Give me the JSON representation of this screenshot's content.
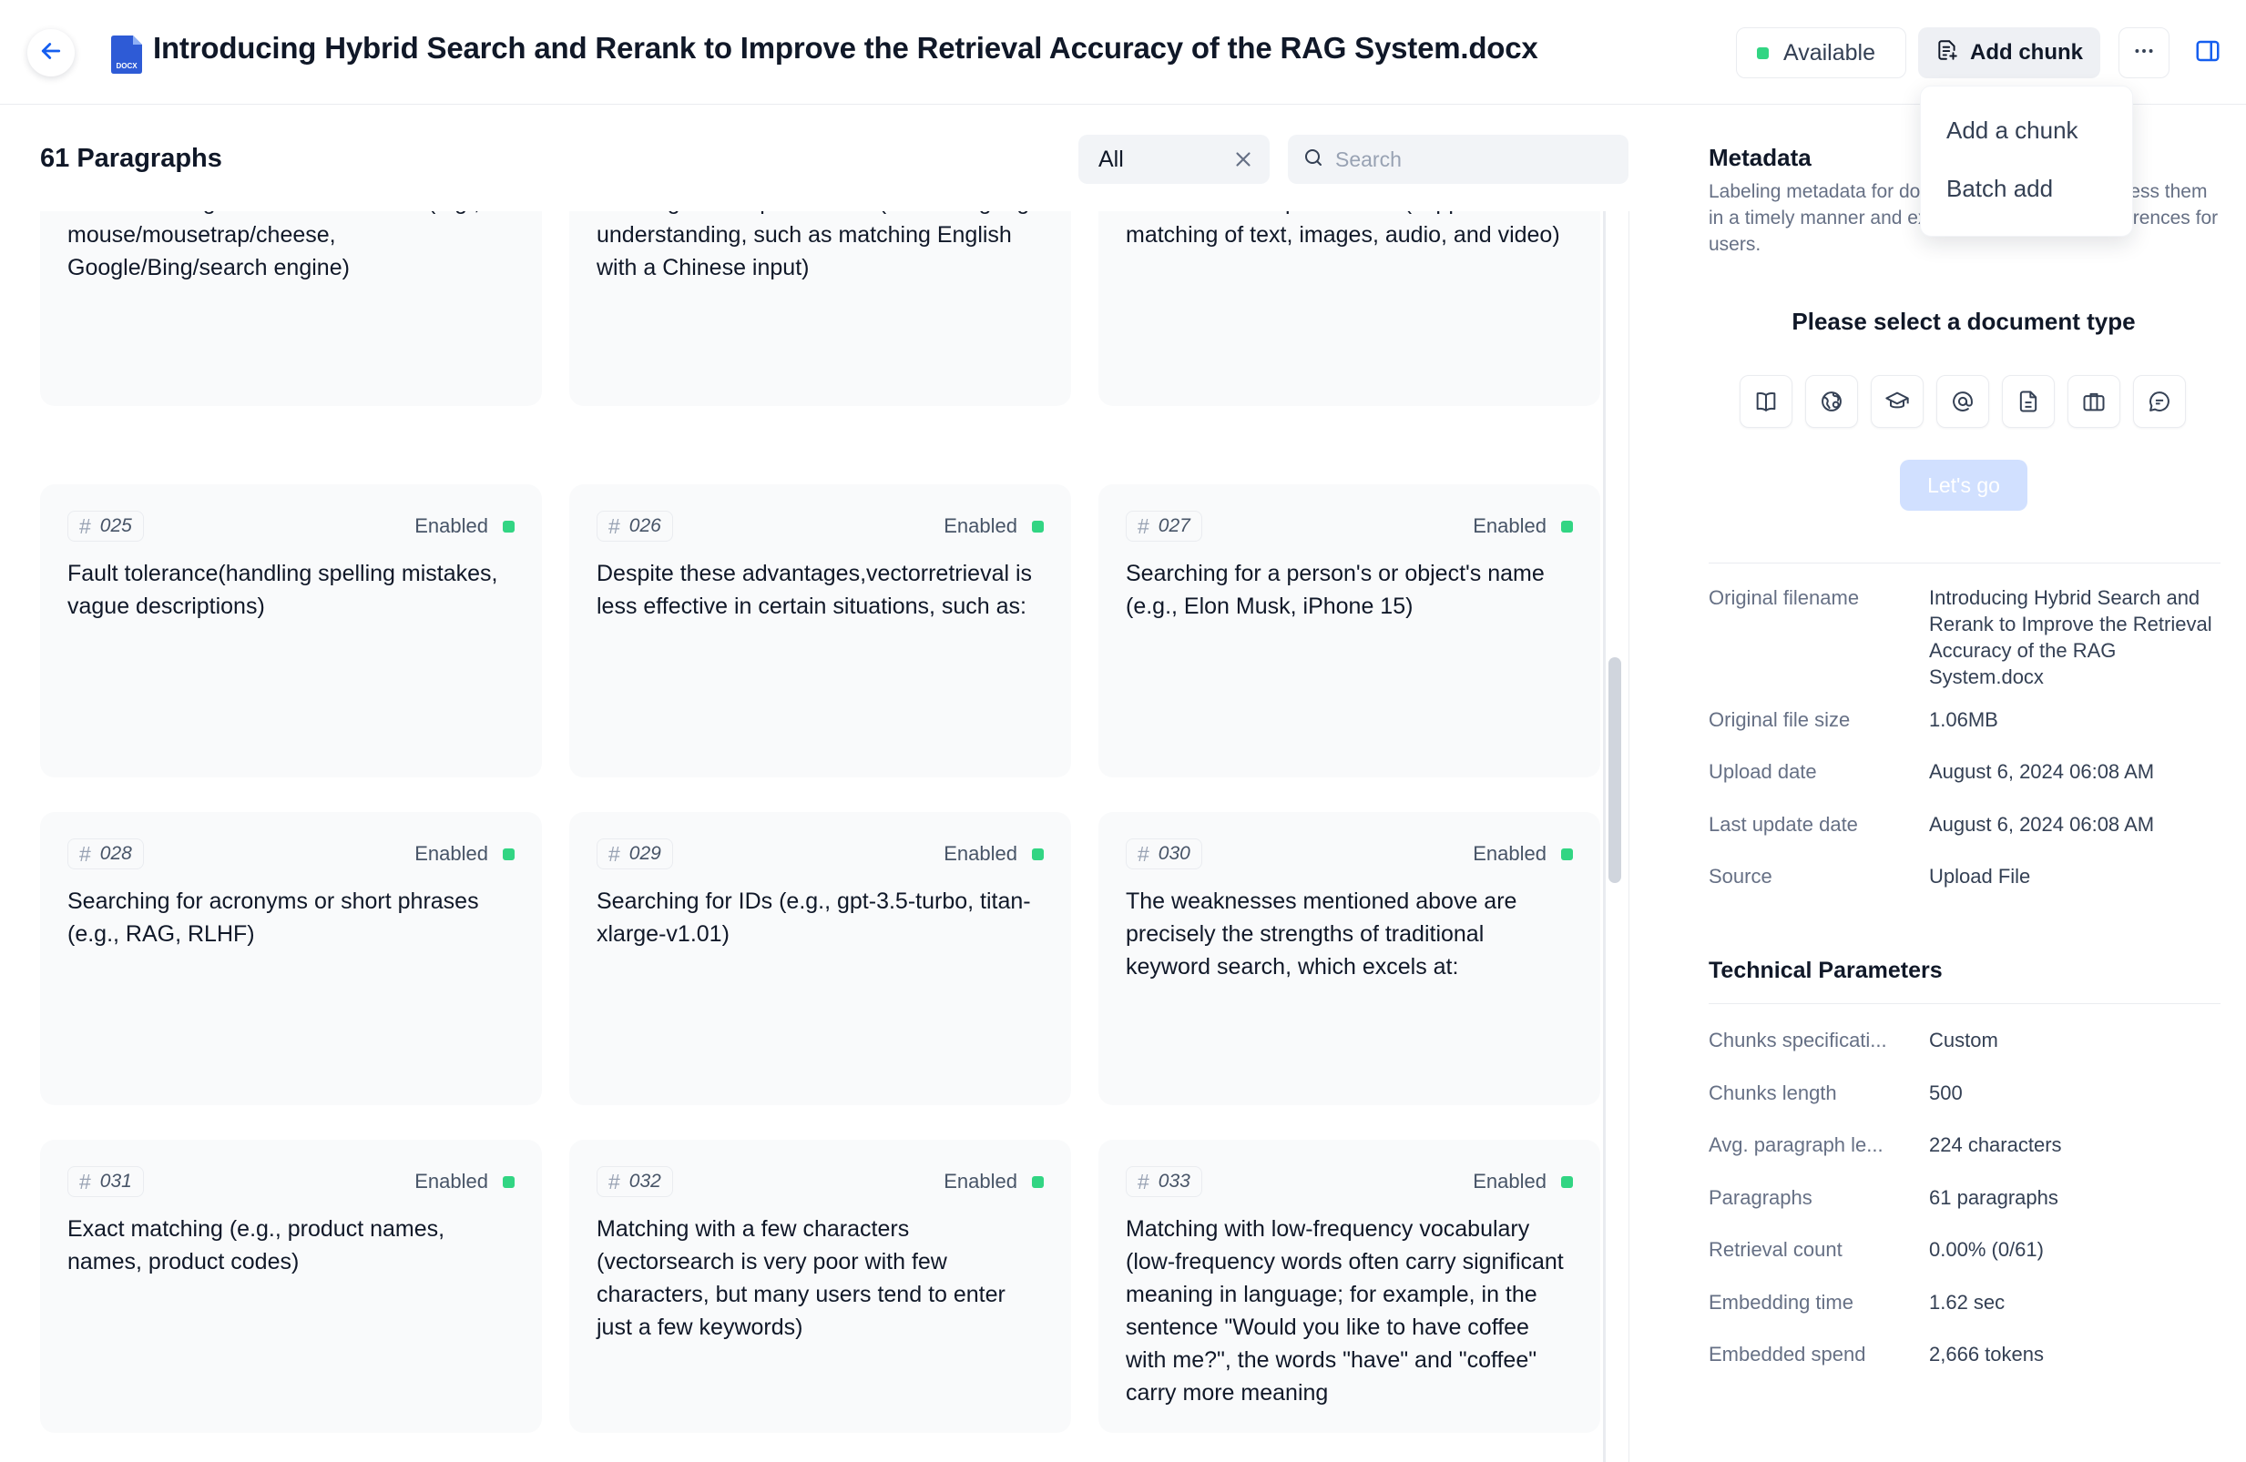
{
  "header": {
    "title": "Introducing Hybrid Search and Rerank to Improve the Retrieval Accuracy of the RAG System.docx",
    "file_badge": "DOCX",
    "status": "Available",
    "status_color": "#32d583",
    "add_chunk_label": "Add chunk",
    "icons": {
      "back": "arrow-left-icon",
      "file": "docx-file-icon",
      "add": "add-chunk-icon",
      "more": "more-horizontal-icon",
      "panel": "panel-toggle-icon"
    }
  },
  "dropdown": {
    "items": [
      "Add a chunk",
      "Batch add"
    ]
  },
  "list": {
    "count_label": "61 Paragraphs",
    "filter_value": "All",
    "search_placeholder": "Search"
  },
  "cards": [
    {
      "num": "",
      "status": "",
      "text": "Understanding of similar semantics (e.g., mouse/mousetrap/cheese, Google/Bing/search engine)"
    },
    {
      "num": "",
      "status": "",
      "text": "Multilingual comprehension (cross-language understanding, such as matching English with a Chinese input)"
    },
    {
      "num": "",
      "status": "",
      "text": "Multimodal comprehension (supports similar matching of text, images, audio, and video)"
    },
    {
      "num": "025",
      "status": "Enabled",
      "text": "Fault tolerance(handling spelling mistakes, vague descriptions)"
    },
    {
      "num": "026",
      "status": "Enabled",
      "text": "Despite these advantages,vectorretrieval is less effective in certain situations, such as:"
    },
    {
      "num": "027",
      "status": "Enabled",
      "text": "Searching for a person's or object's name (e.g., Elon Musk, iPhone 15)"
    },
    {
      "num": "028",
      "status": "Enabled",
      "text": "Searching for acronyms or short phrases (e.g., RAG, RLHF)"
    },
    {
      "num": "029",
      "status": "Enabled",
      "text": "Searching for IDs (e.g., gpt-3.5-turbo, titan-xlarge-v1.01)"
    },
    {
      "num": "030",
      "status": "Enabled",
      "text": "The weaknesses mentioned above are precisely the strengths of traditional keyword search, which excels at:"
    },
    {
      "num": "031",
      "status": "Enabled",
      "text": "Exact matching (e.g., product names, names, product codes)"
    },
    {
      "num": "032",
      "status": "Enabled",
      "text": "Matching with a few characters (vectorsearch is very poor with few characters, but many users tend to enter just a few keywords)"
    },
    {
      "num": "033",
      "status": "Enabled",
      "text": "Matching with low-frequency vocabulary (low-frequency words often carry significant meaning in language; for example, in the sentence \"Would you like to have coffee with me?\", the words \"have\" and \"coffee\" carry more meaning"
    }
  ],
  "metadata": {
    "title": "Metadata",
    "description": "Labeling metadata for documents allows AI to access them in a timely manner and exposes the source of references for users.",
    "select_type_label": "Please select a document type",
    "type_icons": [
      "book-icon",
      "web-icon",
      "graduation-cap-icon",
      "at-sign-icon",
      "file-text-icon",
      "briefcase-icon",
      "chat-bubble-icon"
    ],
    "lets_go_label": "Let's go",
    "info": [
      {
        "label": "Original filename",
        "value": "Introducing Hybrid Search and Rerank to Improve the Retrieval Accuracy of the RAG System.docx"
      },
      {
        "label": "Original file size",
        "value": "1.06MB"
      },
      {
        "label": "Upload date",
        "value": "August 6, 2024 06:08 AM"
      },
      {
        "label": "Last update date",
        "value": "August 6, 2024 06:08 AM"
      },
      {
        "label": "Source",
        "value": "Upload File"
      }
    ]
  },
  "technical": {
    "title": "Technical Parameters",
    "params": [
      {
        "label": "Chunks specificati...",
        "value": "Custom"
      },
      {
        "label": "Chunks length",
        "value": "500"
      },
      {
        "label": "Avg. paragraph le...",
        "value": "224 characters"
      },
      {
        "label": "Paragraphs",
        "value": "61 paragraphs"
      },
      {
        "label": "Retrieval count",
        "value": "0.00% (0/61)"
      },
      {
        "label": "Embedding time",
        "value": "1.62 sec"
      },
      {
        "label": "Embedded spend",
        "value": "2,666 tokens"
      }
    ]
  }
}
